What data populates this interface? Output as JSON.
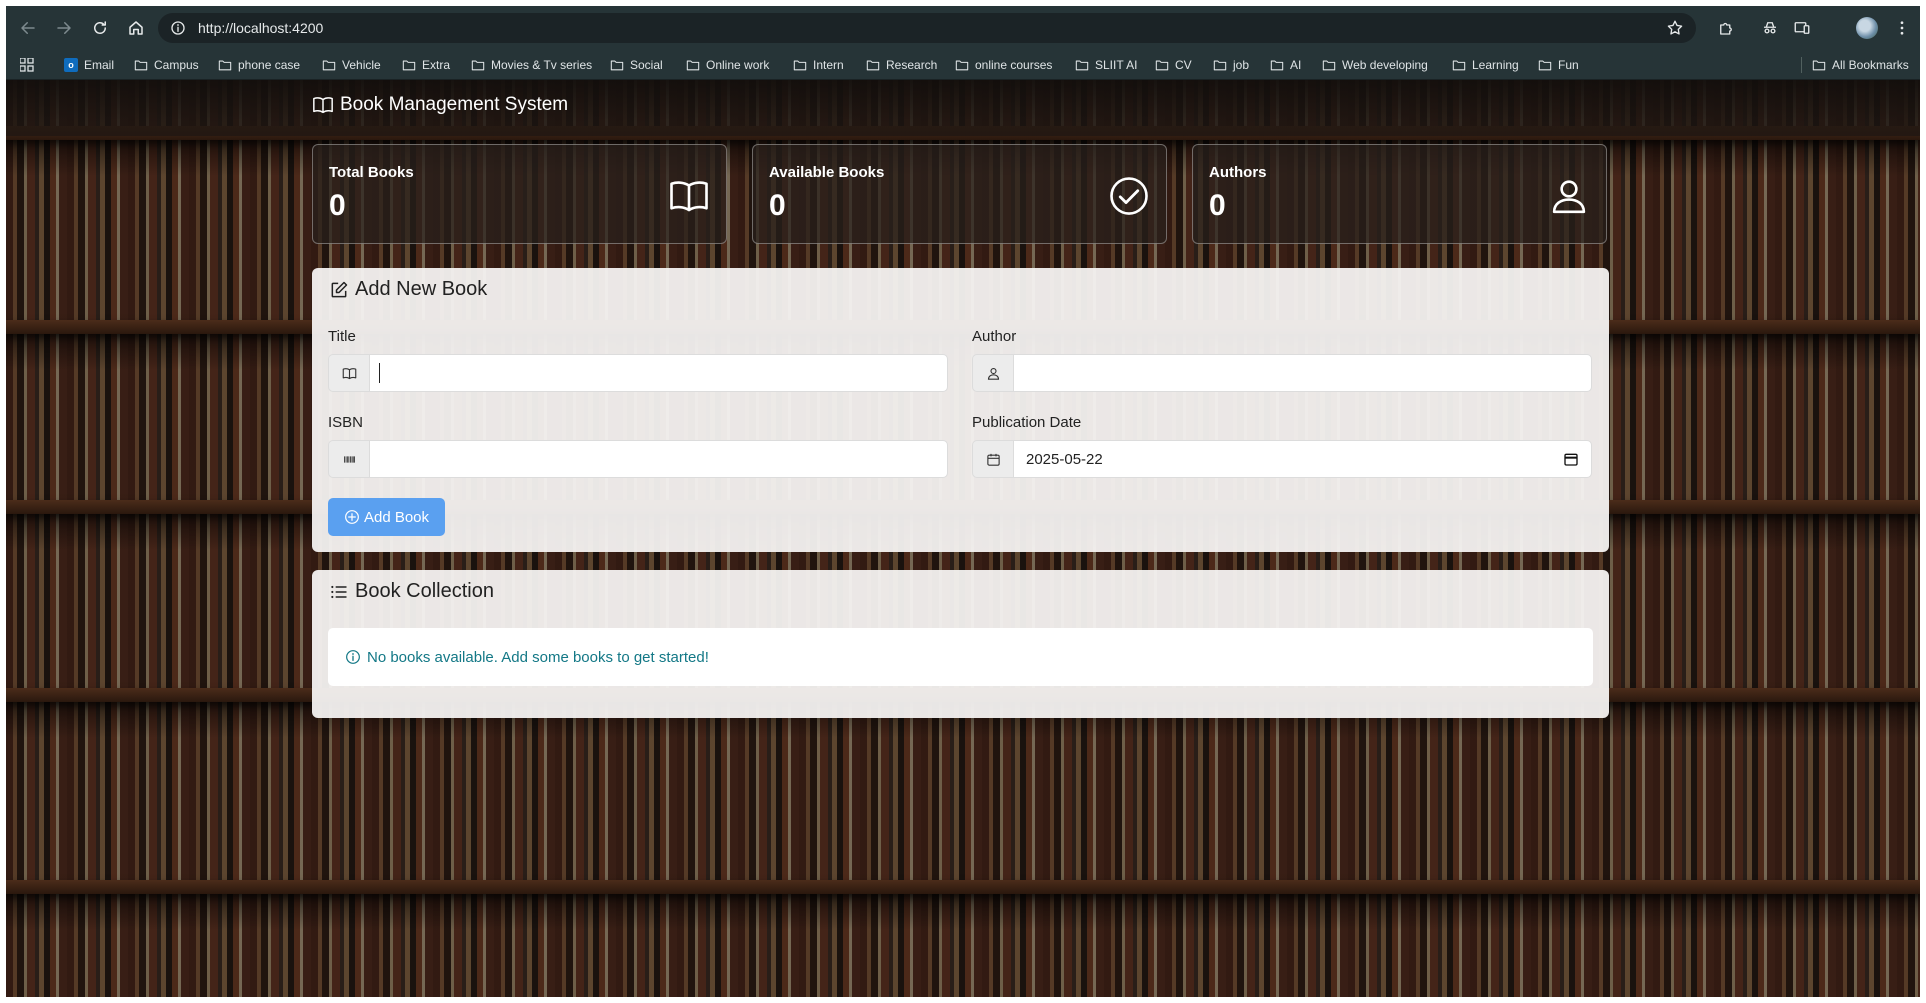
{
  "browser": {
    "url": "http://localhost:4200",
    "bookmarks": [
      {
        "label": "Email",
        "icon": "outlook-icon"
      },
      {
        "label": "Campus",
        "icon": "folder-icon"
      },
      {
        "label": "phone case",
        "icon": "folder-icon"
      },
      {
        "label": "Vehicle",
        "icon": "folder-icon"
      },
      {
        "label": "Extra",
        "icon": "folder-icon"
      },
      {
        "label": "Movies & Tv series",
        "icon": "folder-icon"
      },
      {
        "label": "Social",
        "icon": "folder-icon"
      },
      {
        "label": "Online work",
        "icon": "folder-icon"
      },
      {
        "label": "Intern",
        "icon": "folder-icon"
      },
      {
        "label": "Research",
        "icon": "folder-icon"
      },
      {
        "label": "online courses",
        "icon": "folder-icon"
      },
      {
        "label": "SLIIT AI",
        "icon": "folder-icon"
      },
      {
        "label": "CV",
        "icon": "folder-icon"
      },
      {
        "label": "job",
        "icon": "folder-icon"
      },
      {
        "label": "AI",
        "icon": "folder-icon"
      },
      {
        "label": "Web developing",
        "icon": "folder-icon"
      },
      {
        "label": "Learning",
        "icon": "folder-icon"
      },
      {
        "label": "Fun",
        "icon": "folder-icon"
      }
    ],
    "all_bookmarks": "All Bookmarks"
  },
  "app": {
    "brand": "Book Management System"
  },
  "stats": {
    "total_books": {
      "label": "Total Books",
      "value": "0",
      "icon": "book-open-icon"
    },
    "available_books": {
      "label": "Available Books",
      "value": "0",
      "icon": "check-circle-icon"
    },
    "authors": {
      "label": "Authors",
      "value": "0",
      "icon": "person-icon"
    }
  },
  "add_form": {
    "title": "Add New Book",
    "title_label": "Title",
    "title_value": "",
    "author_label": "Author",
    "author_value": "",
    "isbn_label": "ISBN",
    "isbn_value": "",
    "pub_date_label": "Publication Date",
    "pub_date_value": "2025-05-22",
    "submit_label": "Add Book"
  },
  "collection": {
    "title": "Book Collection",
    "empty_message": "No books available. Add some books to get started!"
  },
  "colors": {
    "primary_button": "#5aa0f0",
    "info_text": "#137886",
    "chrome_bar": "#263437"
  }
}
